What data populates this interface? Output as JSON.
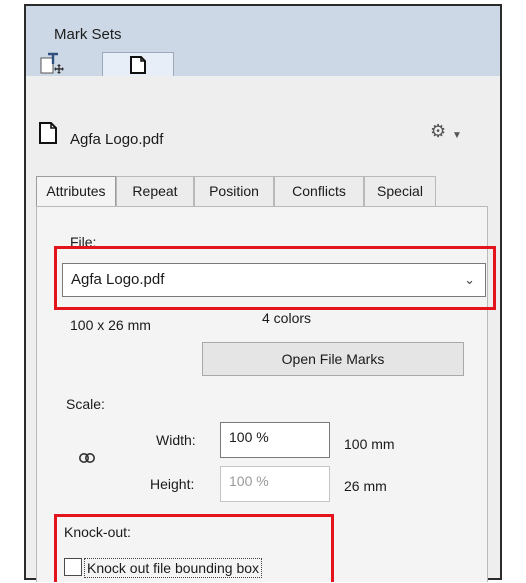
{
  "panel": {
    "title": "Mark Sets",
    "toolbar": [
      {
        "name": "text-mark",
        "icon": "text-mark-icon"
      },
      {
        "name": "file-mark",
        "icon": "file-mark-icon",
        "active": true
      }
    ]
  },
  "file_header": {
    "title": "Agfa Logo.pdf",
    "icon": "file-document-icon",
    "menu_icon": "gear-icon"
  },
  "tabs": [
    {
      "label": "Attributes",
      "active": true
    },
    {
      "label": "Repeat"
    },
    {
      "label": "Position"
    },
    {
      "label": "Conflicts"
    },
    {
      "label": "Special"
    }
  ],
  "attributes": {
    "file_label": "File:",
    "file_value": "Agfa Logo.pdf",
    "dimensions": "100 x 26 mm",
    "colors": "4 colors",
    "open_file_marks": "Open File Marks",
    "scale_label": "Scale:",
    "width_label": "Width:",
    "width_value": "100 %",
    "width_mm": "100 mm",
    "height_label": "Height:",
    "height_value": "100 %",
    "height_mm": "26 mm",
    "knockout_label": "Knock-out:",
    "knockout_checkbox": "Knock out file bounding box",
    "knockout_checked": false
  },
  "colors": {
    "highlight": "#e3141b",
    "header_bg": "#cdd8e6",
    "panel_bg": "#eeeeee"
  }
}
